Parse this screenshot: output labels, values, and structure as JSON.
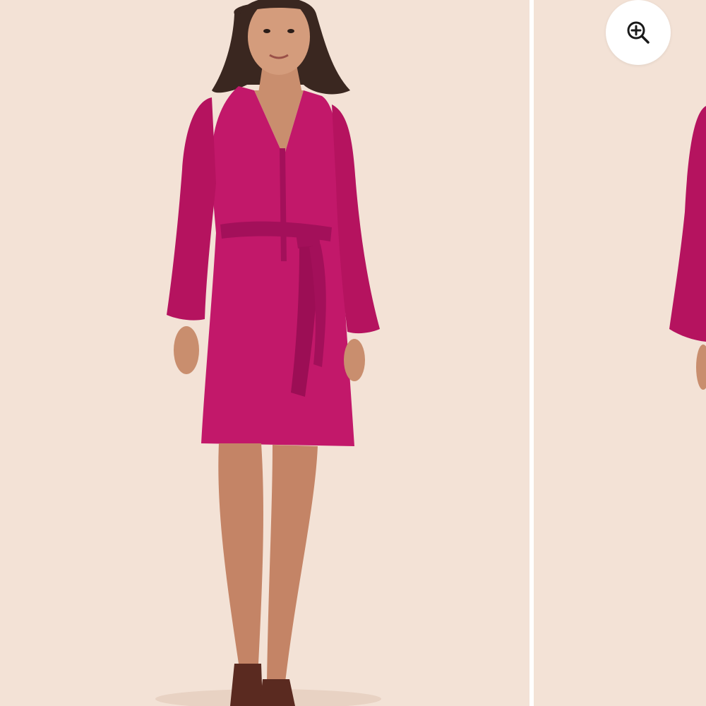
{
  "colors": {
    "background": "#f3e2d6",
    "dress": "#c2186a",
    "gutter": "#ffffff",
    "zoom_button": "#ffffff",
    "icon": "#1a1a1a"
  },
  "gallery": {
    "images": [
      {
        "subject": "model-front-view"
      },
      {
        "subject": "model-partial-view"
      }
    ],
    "zoom_button": {
      "icon": "zoom-in-icon"
    }
  }
}
